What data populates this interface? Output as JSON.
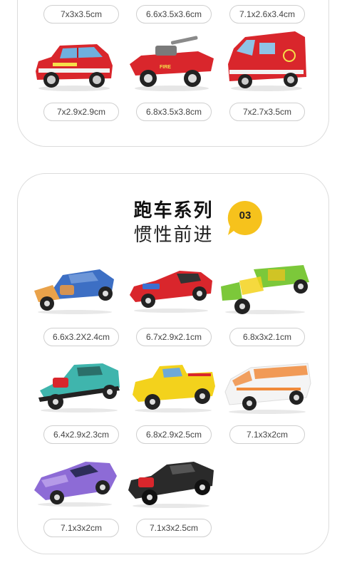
{
  "top_section": {
    "row1_sizes": [
      "7x3x3.5cm",
      "6.6x3.5x3.6cm",
      "7.1x2.6x3.4cm"
    ],
    "row2_sizes": [
      "7x2.9x2.9cm",
      "6.8x3.5x3.8cm",
      "7x2.7x3.5cm"
    ],
    "vehicles": [
      {
        "name": "fire-suv",
        "color": "#d9262c"
      },
      {
        "name": "fire-amphibious-tank",
        "color": "#d9262c"
      },
      {
        "name": "fire-van",
        "color": "#d9262c"
      }
    ]
  },
  "main_section": {
    "title": "跑车系列",
    "subtitle": "惯性前进",
    "badge_number": "03",
    "badge_color": "#f6c21c",
    "sizes": [
      "6.6x3.2X2.4cm",
      "6.7x2.9x2.1cm",
      "6.8x3x2.1cm",
      "6.4x2.9x2.3cm",
      "6.8x2.9x2.5cm",
      "7.1x3x2cm",
      "7.1x3x2cm",
      "7.1x3x2.5cm"
    ],
    "vehicles": [
      {
        "name": "blue-hot-rod",
        "color": "#3d6fc4"
      },
      {
        "name": "red-sports-car",
        "color": "#d9262c"
      },
      {
        "name": "green-hot-rod",
        "color": "#7cc83a"
      },
      {
        "name": "teal-muscle-truck",
        "color": "#3fb5ad"
      },
      {
        "name": "yellow-pickup",
        "color": "#f3d21c"
      },
      {
        "name": "white-orange-van",
        "color": "#f08a3a"
      },
      {
        "name": "purple-supercar",
        "color": "#8d6bd6"
      },
      {
        "name": "black-muscle-car",
        "color": "#2a2a2a"
      }
    ]
  }
}
